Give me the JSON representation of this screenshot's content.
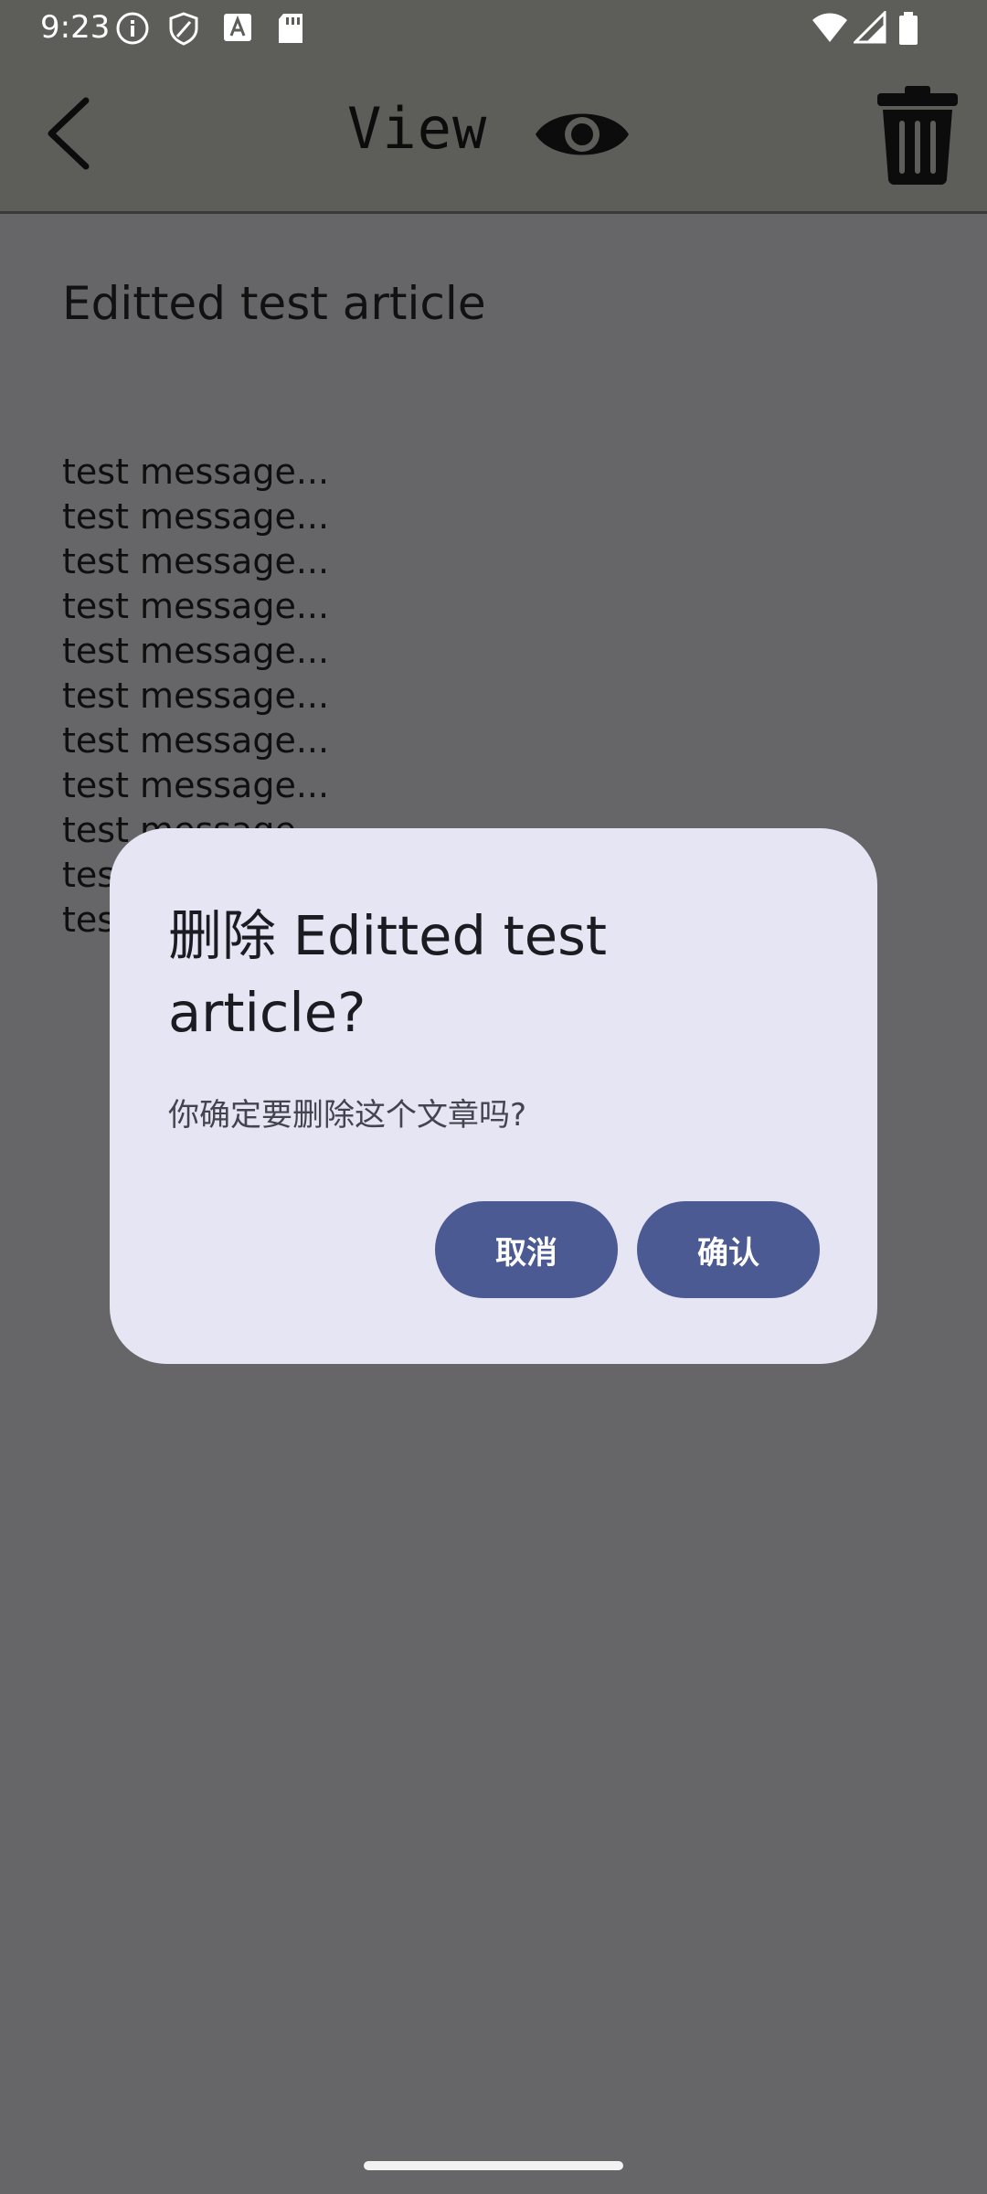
{
  "status_bar": {
    "time": "9:23",
    "icons": [
      "info-icon",
      "shield-icon",
      "font-icon",
      "sd-card-icon",
      "wifi-icon",
      "signal-icon",
      "battery-icon"
    ]
  },
  "app_bar": {
    "title": "View",
    "back_icon": "chevron-left-icon",
    "view_icon": "eye-icon",
    "delete_icon": "trash-icon"
  },
  "article": {
    "title": "Editted test article",
    "lines": [
      "test message...",
      "test message...",
      "test message...",
      "test message...",
      "test message...",
      "test message...",
      "test message...",
      "test message...",
      "test message...",
      "test message...",
      "test message..."
    ]
  },
  "dialog": {
    "title": "删除 Editted test article?",
    "message": "你确定要删除这个文章吗?",
    "cancel_label": "取消",
    "confirm_label": "确认"
  },
  "colors": {
    "scrim_background": "#666668",
    "app_bar": "#5d5d5a",
    "dialog_surface": "#e6e5f3",
    "button_accent": "#4b5a92"
  }
}
